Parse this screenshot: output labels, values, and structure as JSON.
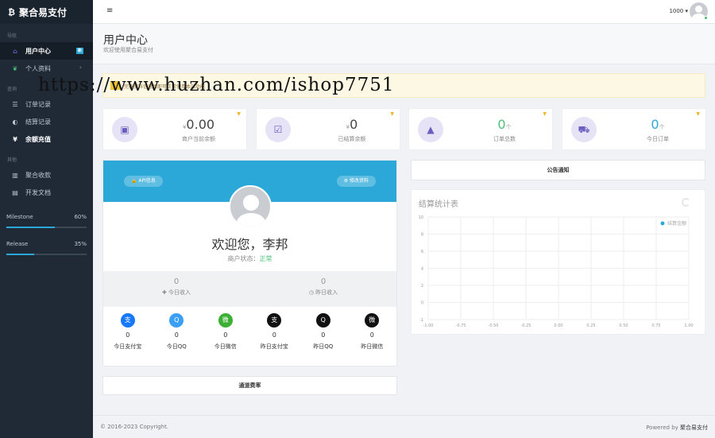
{
  "sidebar": {
    "brand_icon": "₿",
    "brand": "聚合易支付",
    "section_nav": "导航",
    "section_query": "查询",
    "section_other": "其他",
    "items": [
      {
        "label": "用户中心",
        "icon": "home-icon"
      },
      {
        "label": "个人资料",
        "icon": "leaf-icon"
      },
      {
        "label": "订单记录",
        "icon": "list-icon"
      },
      {
        "label": "结算记录",
        "icon": "settle-icon"
      },
      {
        "label": "余额充值",
        "icon": "yen-icon"
      },
      {
        "label": "聚合收款",
        "icon": "barcode-icon"
      },
      {
        "label": "开发文档",
        "icon": "book-icon"
      }
    ],
    "badge": "新",
    "progress": [
      {
        "label": "Milestone",
        "percent_text": "60%",
        "percent": 60
      },
      {
        "label": "Release",
        "percent_text": "35%",
        "percent": 35
      }
    ]
  },
  "topbar": {
    "menu_icon": "≡",
    "user_label": "1000 ▾"
  },
  "header": {
    "title": "用户中心",
    "subtitle": "欢迎使用聚合易支付"
  },
  "notice": {
    "text": "完善资料信息后即可正常使用本站功能"
  },
  "watermark": "https://www.huzhan.com/ishop7751",
  "stats": [
    {
      "prefix": "¥",
      "value": "0.00",
      "suffix": "",
      "label": "商户当前余额",
      "icon": "money-icon",
      "glyph": "▣"
    },
    {
      "prefix": "¥",
      "value": "0",
      "suffix": "",
      "label": "已结算余额",
      "icon": "check-icon",
      "glyph": "☑"
    },
    {
      "prefix": "",
      "value": "0",
      "suffix": "个",
      "label": "订单总数",
      "icon": "area-chart-icon",
      "glyph": "▲"
    },
    {
      "prefix": "",
      "value": "0",
      "suffix": "个",
      "label": "今日订单",
      "icon": "cart-icon",
      "glyph": "⛟"
    }
  ],
  "profile": {
    "api_button": "API信息",
    "edit_button": "修改资料",
    "welcome": "欢迎您，李邦",
    "status_label": "商户状态：",
    "status_value": "正常",
    "income_today_value": "0",
    "income_today_label": "今日收入",
    "income_yesterday_value": "0",
    "income_yesterday_label": "昨日收入",
    "payments": [
      {
        "value": "0",
        "label": "今日支付宝",
        "color": "#1677ff",
        "glyph": "支",
        "icon": "alipay-icon"
      },
      {
        "value": "0",
        "label": "今日QQ",
        "color": "#3ba0f5",
        "glyph": "Q",
        "icon": "qq-icon"
      },
      {
        "value": "0",
        "label": "今日微信",
        "color": "#3cb034",
        "glyph": "微",
        "icon": "wechat-icon"
      },
      {
        "value": "0",
        "label": "昨日支付宝",
        "color": "#111111",
        "glyph": "支",
        "icon": "alipay-icon"
      },
      {
        "value": "0",
        "label": "昨日QQ",
        "color": "#111111",
        "glyph": "Q",
        "icon": "qq-icon"
      },
      {
        "value": "0",
        "label": "昨日微信",
        "color": "#111111",
        "glyph": "微",
        "icon": "wechat-icon"
      }
    ]
  },
  "channel_rate": "通道费率",
  "announcement": "公告通知",
  "chart_title": "结算统计表",
  "chart_data": {
    "type": "line",
    "legend": [
      "结算金额"
    ],
    "legend_color": "#2ba8d8",
    "xlim": [
      -1.0,
      1.0
    ],
    "ylim": [
      -1,
      10
    ],
    "x_ticks": [
      "-1.00",
      "-0.75",
      "-0.50",
      "-0.25",
      "0.00",
      "0.25",
      "0.50",
      "0.75",
      "1.00"
    ],
    "y_ticks": [
      "10",
      "8",
      "6",
      "4",
      "2",
      "0",
      "-1"
    ],
    "series": [
      {
        "name": "结算金额",
        "values": []
      }
    ],
    "grid": true,
    "legend_position": "top-right"
  },
  "footer": {
    "copyright": "© 2016-2023 Copyright.",
    "powered_prefix": "Powered by ",
    "powered_brand": "聚合易支付"
  }
}
